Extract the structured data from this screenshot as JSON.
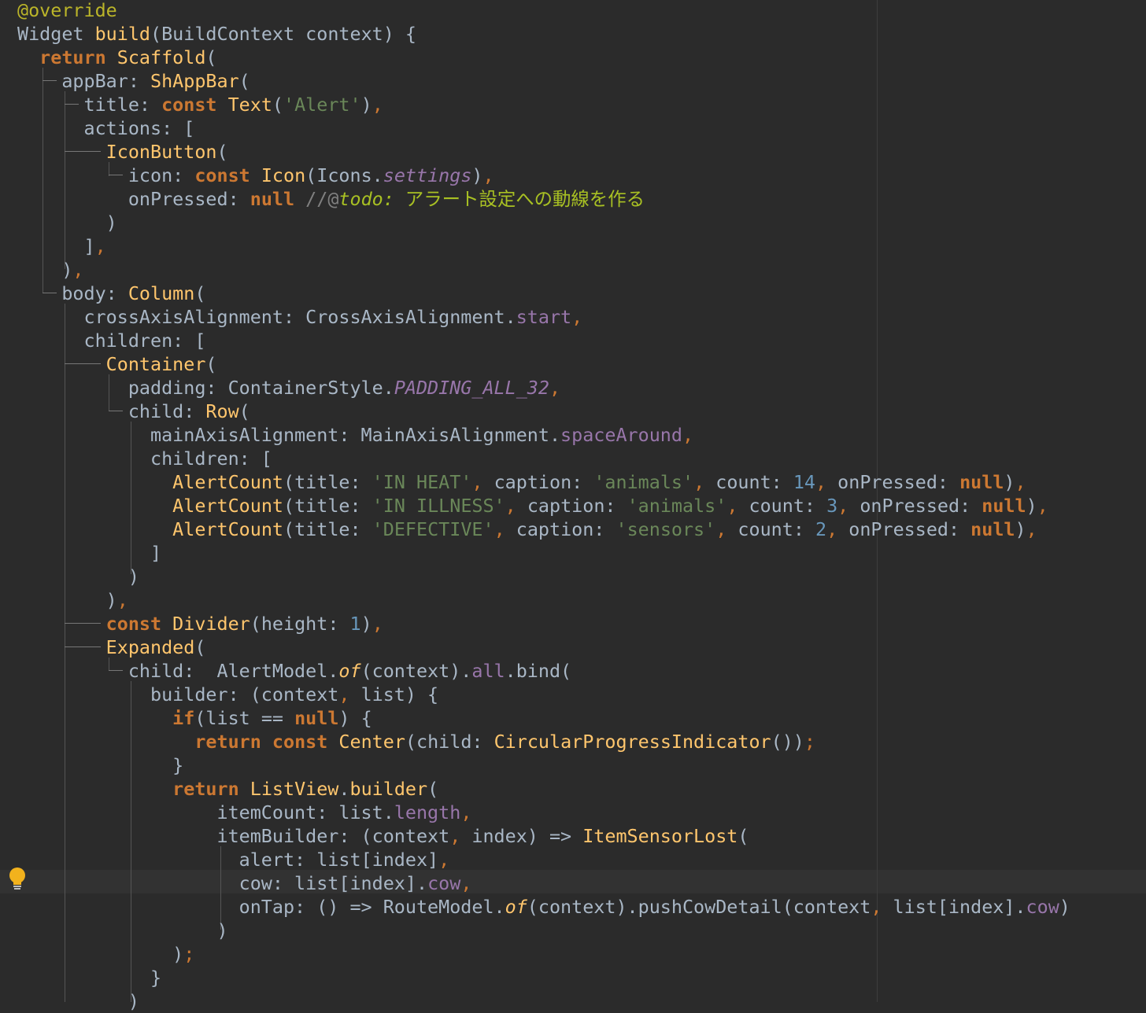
{
  "editor": {
    "language": "dart",
    "lines": [
      [
        [
          "ann",
          "@override"
        ]
      ],
      [
        [
          "plain",
          "Widget "
        ],
        [
          "fn",
          "build"
        ],
        [
          "plain",
          "(BuildContext context) {"
        ]
      ],
      [
        [
          "plain",
          "  "
        ],
        [
          "kw",
          "return "
        ],
        [
          "fn",
          "Scaffold"
        ],
        [
          "plain",
          "("
        ]
      ],
      [
        [
          "plain",
          "    appBar: "
        ],
        [
          "fn",
          "ShAppBar"
        ],
        [
          "plain",
          "("
        ]
      ],
      [
        [
          "plain",
          "      title: "
        ],
        [
          "kw",
          "const "
        ],
        [
          "fn",
          "Text"
        ],
        [
          "plain",
          "("
        ],
        [
          "str",
          "'Alert'"
        ],
        [
          "plain",
          ")"
        ],
        [
          "punct",
          ","
        ]
      ],
      [
        [
          "plain",
          "      actions: ["
        ]
      ],
      [
        [
          "plain",
          "        "
        ],
        [
          "fn",
          "IconButton"
        ],
        [
          "plain",
          "("
        ]
      ],
      [
        [
          "plain",
          "          icon: "
        ],
        [
          "kw",
          "const "
        ],
        [
          "fn",
          "Icon"
        ],
        [
          "plain",
          "(Icons."
        ],
        [
          "italic",
          "settings"
        ],
        [
          "plain",
          ")"
        ],
        [
          "punct",
          ","
        ]
      ],
      [
        [
          "plain",
          "          onPressed: "
        ],
        [
          "kw",
          "null "
        ],
        [
          "cmt",
          "//@"
        ],
        [
          "todo",
          "todo: "
        ],
        [
          "todotext",
          "アラート設定への動線を作る"
        ]
      ],
      [
        [
          "plain",
          "        )"
        ]
      ],
      [
        [
          "plain",
          "      ]"
        ],
        [
          "punct",
          ","
        ]
      ],
      [
        [
          "plain",
          "    )"
        ],
        [
          "punct",
          ","
        ]
      ],
      [
        [
          "plain",
          "    body: "
        ],
        [
          "fn",
          "Column"
        ],
        [
          "plain",
          "("
        ]
      ],
      [
        [
          "plain",
          "      crossAxisAlignment: CrossAxisAlignment."
        ],
        [
          "prop",
          "start"
        ],
        [
          "punct",
          ","
        ]
      ],
      [
        [
          "plain",
          "      children: ["
        ]
      ],
      [
        [
          "plain",
          "        "
        ],
        [
          "fn",
          "Container"
        ],
        [
          "plain",
          "("
        ]
      ],
      [
        [
          "plain",
          "          padding: ContainerStyle."
        ],
        [
          "italic",
          "PADDING_ALL_32"
        ],
        [
          "punct",
          ","
        ]
      ],
      [
        [
          "plain",
          "          child: "
        ],
        [
          "fn",
          "Row"
        ],
        [
          "plain",
          "("
        ]
      ],
      [
        [
          "plain",
          "            mainAxisAlignment: MainAxisAlignment."
        ],
        [
          "prop",
          "spaceAround"
        ],
        [
          "punct",
          ","
        ]
      ],
      [
        [
          "plain",
          "            children: ["
        ]
      ],
      [
        [
          "plain",
          "              "
        ],
        [
          "fn",
          "AlertCount"
        ],
        [
          "plain",
          "(title: "
        ],
        [
          "str",
          "'IN HEAT'"
        ],
        [
          "punct",
          ", "
        ],
        [
          "plain",
          "caption: "
        ],
        [
          "str",
          "'animals'"
        ],
        [
          "punct",
          ", "
        ],
        [
          "plain",
          "count: "
        ],
        [
          "num",
          "14"
        ],
        [
          "punct",
          ", "
        ],
        [
          "plain",
          "onPressed: "
        ],
        [
          "kw",
          "null"
        ],
        [
          "plain",
          ")"
        ],
        [
          "punct",
          ","
        ]
      ],
      [
        [
          "plain",
          "              "
        ],
        [
          "fn",
          "AlertCount"
        ],
        [
          "plain",
          "(title: "
        ],
        [
          "str",
          "'IN ILLNESS'"
        ],
        [
          "punct",
          ", "
        ],
        [
          "plain",
          "caption: "
        ],
        [
          "str",
          "'animals'"
        ],
        [
          "punct",
          ", "
        ],
        [
          "plain",
          "count: "
        ],
        [
          "num",
          "3"
        ],
        [
          "punct",
          ", "
        ],
        [
          "plain",
          "onPressed: "
        ],
        [
          "kw",
          "null"
        ],
        [
          "plain",
          ")"
        ],
        [
          "punct",
          ","
        ]
      ],
      [
        [
          "plain",
          "              "
        ],
        [
          "fn",
          "AlertCount"
        ],
        [
          "plain",
          "(title: "
        ],
        [
          "str",
          "'DEFECTIVE'"
        ],
        [
          "punct",
          ", "
        ],
        [
          "plain",
          "caption: "
        ],
        [
          "str",
          "'sensors'"
        ],
        [
          "punct",
          ", "
        ],
        [
          "plain",
          "count: "
        ],
        [
          "num",
          "2"
        ],
        [
          "punct",
          ", "
        ],
        [
          "plain",
          "onPressed: "
        ],
        [
          "kw",
          "null"
        ],
        [
          "plain",
          ")"
        ],
        [
          "punct",
          ","
        ]
      ],
      [
        [
          "plain",
          "            ]"
        ]
      ],
      [
        [
          "plain",
          "          )"
        ]
      ],
      [
        [
          "plain",
          "        )"
        ],
        [
          "punct",
          ","
        ]
      ],
      [
        [
          "plain",
          "        "
        ],
        [
          "kw",
          "const "
        ],
        [
          "fn",
          "Divider"
        ],
        [
          "plain",
          "(height: "
        ],
        [
          "num",
          "1"
        ],
        [
          "plain",
          ")"
        ],
        [
          "punct",
          ","
        ]
      ],
      [
        [
          "plain",
          "        "
        ],
        [
          "fn",
          "Expanded"
        ],
        [
          "plain",
          "("
        ]
      ],
      [
        [
          "plain",
          "          child:  AlertModel."
        ],
        [
          "stat",
          "of"
        ],
        [
          "plain",
          "(context)."
        ],
        [
          "prop",
          "all"
        ],
        [
          "plain",
          ".bind("
        ]
      ],
      [
        [
          "plain",
          "            builder: (context"
        ],
        [
          "punct",
          ", "
        ],
        [
          "plain",
          "list) {"
        ]
      ],
      [
        [
          "plain",
          "              "
        ],
        [
          "kw",
          "if"
        ],
        [
          "plain",
          "(list == "
        ],
        [
          "kw",
          "null"
        ],
        [
          "plain",
          ") {"
        ]
      ],
      [
        [
          "plain",
          "                "
        ],
        [
          "kw",
          "return const "
        ],
        [
          "fn",
          "Center"
        ],
        [
          "plain",
          "(child: "
        ],
        [
          "fn",
          "CircularProgressIndicator"
        ],
        [
          "plain",
          "())"
        ],
        [
          "punct",
          ";"
        ]
      ],
      [
        [
          "plain",
          "              }"
        ]
      ],
      [
        [
          "plain",
          "              "
        ],
        [
          "kw",
          "return "
        ],
        [
          "fn",
          "ListView"
        ],
        [
          "plain",
          "."
        ],
        [
          "fn",
          "builder"
        ],
        [
          "plain",
          "("
        ]
      ],
      [
        [
          "plain",
          "                  itemCount: list."
        ],
        [
          "prop",
          "length"
        ],
        [
          "punct",
          ","
        ]
      ],
      [
        [
          "plain",
          "                  itemBuilder: (context"
        ],
        [
          "punct",
          ", "
        ],
        [
          "plain",
          "index) => "
        ],
        [
          "fn",
          "ItemSensorLost"
        ],
        [
          "plain",
          "("
        ]
      ],
      [
        [
          "plain",
          "                    alert: list[index]"
        ],
        [
          "punct",
          ","
        ]
      ],
      [
        [
          "plain",
          "                    cow: list[index]."
        ],
        [
          "prop",
          "cow"
        ],
        [
          "punct",
          ","
        ]
      ],
      [
        [
          "plain",
          "                    onTap: () => RouteModel."
        ],
        [
          "stat",
          "of"
        ],
        [
          "plain",
          "(context).pushCowDetail(context"
        ],
        [
          "punct",
          ", "
        ],
        [
          "plain",
          "list[index]."
        ],
        [
          "prop",
          "cow"
        ],
        [
          "plain",
          ")"
        ]
      ],
      [
        [
          "plain",
          "                  )"
        ]
      ],
      [
        [
          "plain",
          "              )"
        ],
        [
          "punct",
          ";"
        ]
      ],
      [
        [
          "plain",
          "            }"
        ]
      ],
      [
        [
          "plain",
          "          )"
        ]
      ]
    ]
  },
  "gutter": {
    "intention_action_icon": "lightbulb-icon"
  },
  "colors": {
    "background": "#2b2b2b",
    "keyword": "#cc7832",
    "function": "#ffc66d",
    "string": "#6a8759",
    "number": "#6897bb",
    "property": "#9876aa",
    "annotation": "#bbb529",
    "comment": "#808080",
    "todo": "#a8c023",
    "text": "#a9b7c6"
  }
}
